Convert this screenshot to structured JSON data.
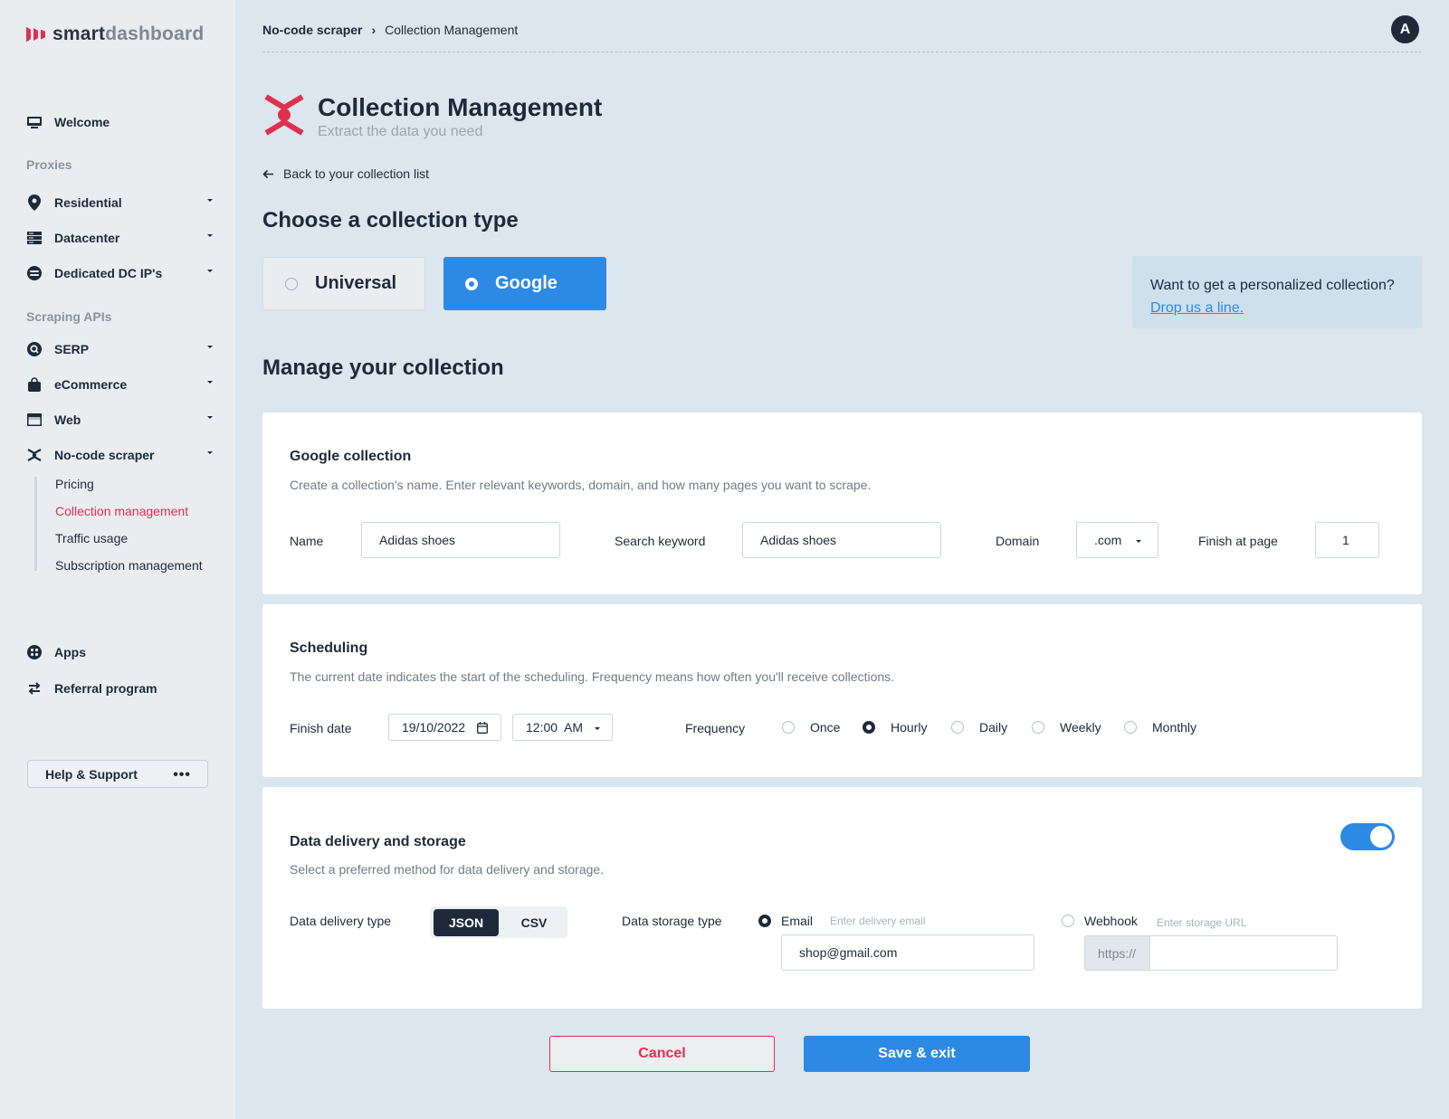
{
  "brand": {
    "name_part1": "smart",
    "name_part2": "dashboard"
  },
  "sidebar": {
    "welcome": "Welcome",
    "section_proxies": "Proxies",
    "proxies": [
      "Residential",
      "Datacenter",
      "Dedicated DC IP's"
    ],
    "section_scraping": "Scraping APIs",
    "scraping": [
      "SERP",
      "eCommerce",
      "Web",
      "No-code scraper"
    ],
    "sub_items": [
      "Pricing",
      "Collection management",
      "Traffic usage",
      "Subscription management"
    ],
    "apps": "Apps",
    "referral": "Referral program",
    "help": "Help & Support"
  },
  "header": {
    "breadcrumb_parent": "No-code scraper",
    "breadcrumb_current": "Collection Management",
    "avatar_initial": "A"
  },
  "page": {
    "title": "Collection Management",
    "subtitle": "Extract the data you need",
    "back_link": "Back to your collection list",
    "choose_type_heading": "Choose a collection type",
    "type_universal": "Universal",
    "type_google": "Google",
    "promo_text": "Want to get a personalized collection?",
    "promo_link": "Drop us a line.",
    "manage_heading": "Manage your collection"
  },
  "google_collection": {
    "title": "Google collection",
    "desc": "Create a collection's name. Enter relevant keywords, domain, and how many pages you want to scrape.",
    "name_label": "Name",
    "name_value": "Adidas shoes",
    "keyword_label": "Search keyword",
    "keyword_value": "Adidas shoes",
    "domain_label": "Domain",
    "domain_value": ".com",
    "finish_page_label": "Finish at page",
    "finish_page_value": "1"
  },
  "scheduling": {
    "title": "Scheduling",
    "desc": "The current date indicates the start of the scheduling. Frequency means how often you'll receive collections.",
    "finish_date_label": "Finish date",
    "finish_date_value": "19/10/2022",
    "time_value": "12:00  AM",
    "frequency_label": "Frequency",
    "frequency_options": [
      "Once",
      "Hourly",
      "Daily",
      "Weekly",
      "Monthly"
    ],
    "frequency_selected": "Hourly"
  },
  "delivery": {
    "title": "Data delivery and storage",
    "desc": "Select a preferred method for data delivery and storage.",
    "enabled": true,
    "delivery_type_label": "Data delivery type",
    "delivery_json": "JSON",
    "delivery_csv": "CSV",
    "storage_type_label": "Data storage type",
    "email_label": "Email",
    "email_hint": "Enter delivery email",
    "email_value": "shop@gmail.com",
    "webhook_label": "Webhook",
    "webhook_hint": "Enter storage URL",
    "url_prefix": "https://"
  },
  "actions": {
    "cancel": "Cancel",
    "save": "Save & exit"
  },
  "colors": {
    "accent": "#2d8ae4",
    "brand_red": "#e0304e",
    "dark": "#1e2a3a"
  }
}
